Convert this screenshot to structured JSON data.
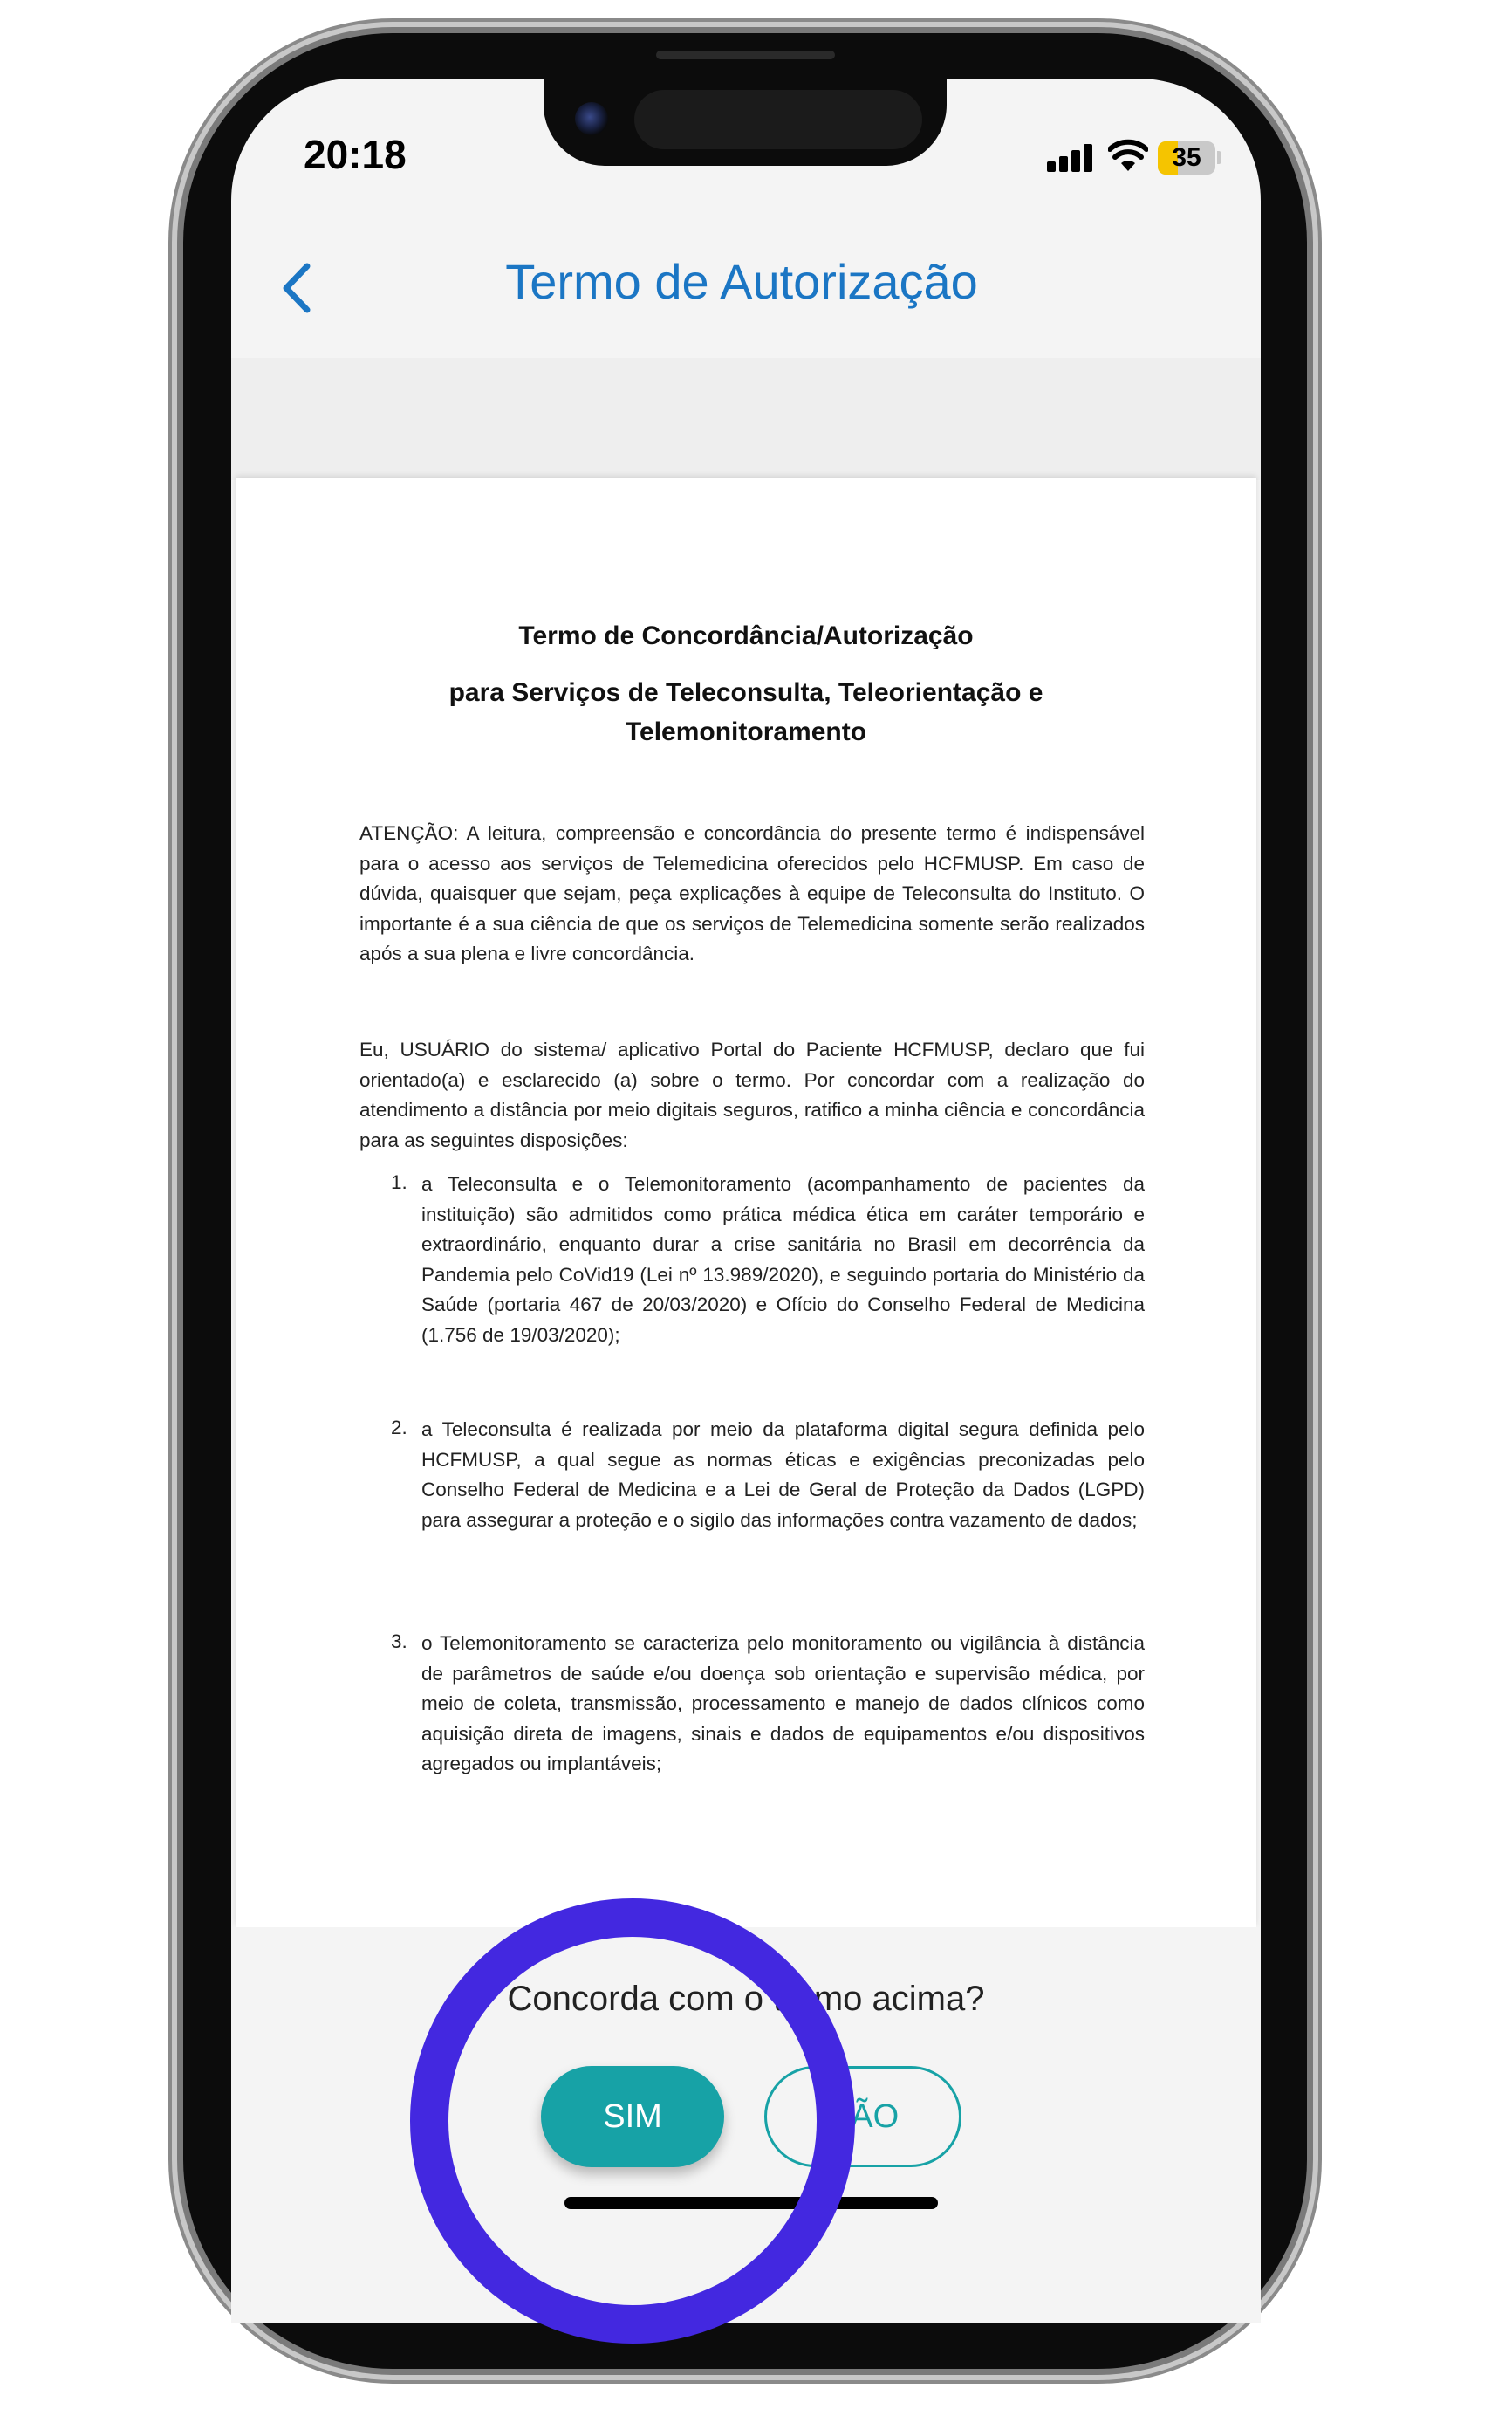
{
  "status_bar": {
    "time": "20:18",
    "battery_level": "35",
    "battery_fraction": 0.35,
    "icons": [
      "signal-icon",
      "wifi-icon",
      "battery-icon"
    ]
  },
  "nav": {
    "back_icon": "chevron-left-icon",
    "title": "Termo de Autorização"
  },
  "document": {
    "title_line1": "Termo de Concordância/Autorização",
    "title_line2": "para Serviços de Teleconsulta, Teleorientação e",
    "title_line3": "Telemonitoramento",
    "attention": "ATENÇÃO: A leitura, compreensão e concordância do presente termo é indispensável para o acesso aos serviços de Telemedicina oferecidos pelo HCFMUSP. Em caso de dúvida, quaisquer que sejam, peça explicações à equipe de Teleconsulta do Instituto. O importante é a sua ciência de que os serviços de Telemedicina somente serão realizados após a sua plena e livre concordância.",
    "declaration": "Eu, USUÁRIO do sistema/ aplicativo Portal do Paciente HCFMUSP, declaro que fui orientado(a) e esclarecido (a) sobre o termo. Por concordar com a realização do atendimento a distância por meio digitais seguros, ratifico a minha ciência e concordância para as seguintes disposições:",
    "items": [
      {
        "number": "1.",
        "text": "a Teleconsulta e o Telemonitoramento (acompanhamento de pacientes da instituição) são admitidos como prática médica ética em caráter temporário e extraordinário, enquanto durar a crise sanitária no Brasil em decorrência da Pandemia pelo CoVid19 (Lei nº 13.989/2020), e seguindo portaria do Ministério da Saúde (portaria 467 de 20/03/2020) e Ofício do Conselho Federal de Medicina (1.756 de 19/03/2020);"
      },
      {
        "number": "2.",
        "text": "a Teleconsulta é realizada por meio da plataforma digital segura definida pelo HCFMUSP, a qual segue as normas éticas e exigências preconizadas pelo Conselho Federal de Medicina e a Lei de Geral de Proteção da Dados (LGPD) para assegurar a proteção e o sigilo das informações contra vazamento de dados;"
      },
      {
        "number": "3.",
        "text": "o Telemonitoramento se caracteriza pelo monitoramento ou vigilância à distância de parâmetros de saúde e/ou doença sob orientação e supervisão médica, por meio de coleta, transmissão, processamento e manejo de dados clínicos como aquisição direta de imagens, sinais e dados de equipamentos e/ou dispositivos agregados ou implantáveis;"
      }
    ]
  },
  "consent": {
    "question": "Concorda com o termo acima?",
    "yes_label": "SIM",
    "no_label": "NÃO"
  },
  "colors": {
    "accent": "#1b76c4",
    "button_teal": "#17a2a6",
    "highlight_ring": "#4328e0"
  }
}
